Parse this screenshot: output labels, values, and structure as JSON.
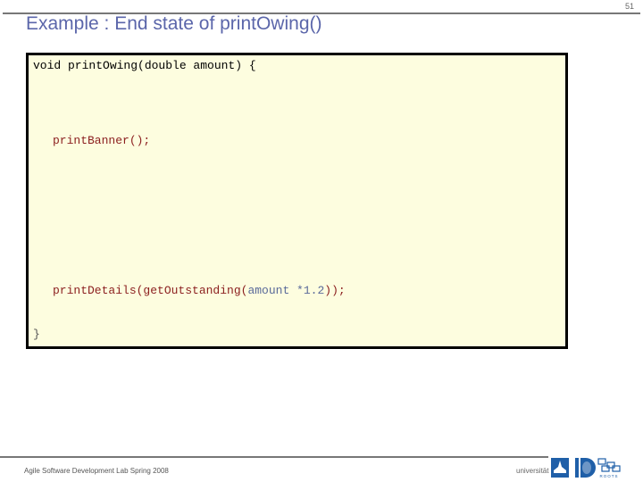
{
  "slide": {
    "page_number": "51",
    "title": "Example : End state of printOwing()"
  },
  "code": {
    "line1": "void printOwing(double amount) {",
    "line2": "printBanner();",
    "line3_prefix": "printDetails(getOutstanding(",
    "line3_arg": "amount *1.2",
    "line3_suffix": "));",
    "line4": "}"
  },
  "footer": {
    "course": "Agile Software Development Lab Spring 2008",
    "university": "universität bonn",
    "roots_label": "ROOTS"
  },
  "colors": {
    "title": "#5b66aa",
    "code_background": "#fdfddf",
    "code_call": "#8b1e1e",
    "code_argument": "#5a6a9a",
    "logo_blue": "#1f5fa8"
  }
}
